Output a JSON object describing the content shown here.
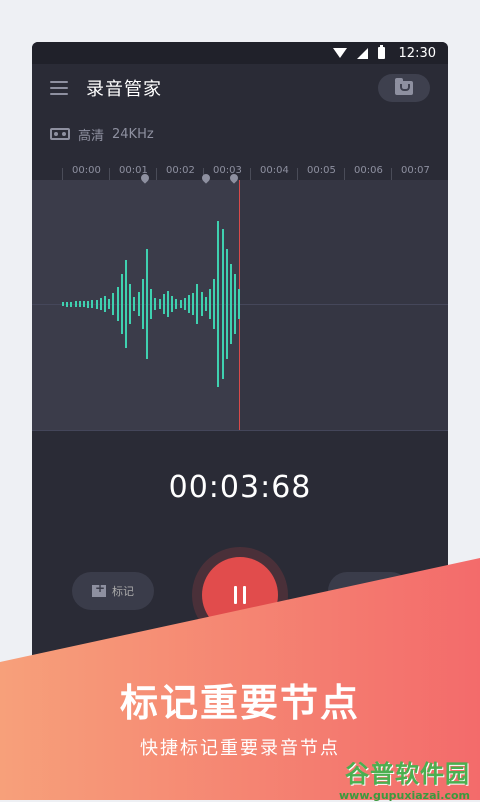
{
  "status": {
    "time": "12:30"
  },
  "toolbar": {
    "title": "录音管家"
  },
  "quality": {
    "label": "高清",
    "rate": "24KHz"
  },
  "timeline": {
    "ticks": [
      "00:00",
      "00:01",
      "00:02",
      "00:03",
      "00:04",
      "00:05",
      "00:06",
      "00:07"
    ]
  },
  "waveform": {
    "color": "#3fd1b0",
    "playhead_color": "#d84a4a",
    "playhead_seconds": 3.0,
    "markers_seconds": [
      1.0,
      2.3,
      2.9
    ]
  },
  "timer": {
    "value": "00:03:68"
  },
  "controls": {
    "mark_label": "标记"
  },
  "promo": {
    "headline": "标记重要节点",
    "subline": "快捷标记重要录音节点"
  },
  "watermark": {
    "name": "谷普软件园",
    "url": "www.gupuxiazai.com"
  }
}
